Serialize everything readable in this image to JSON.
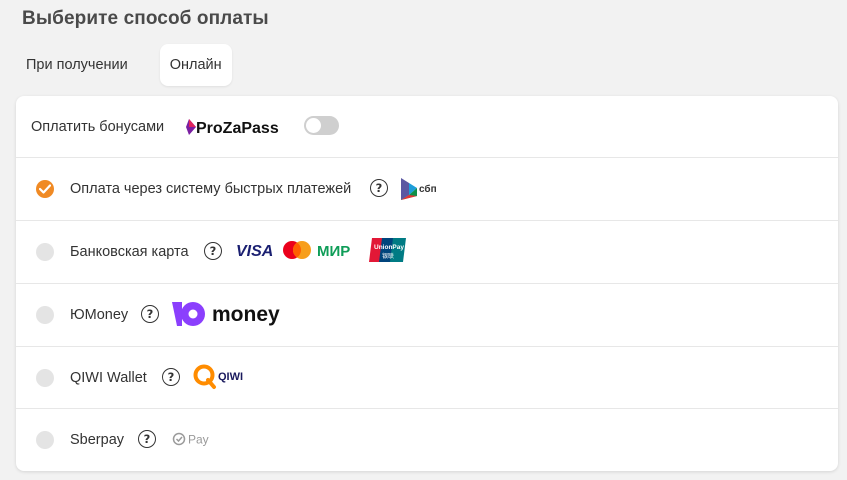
{
  "header": {
    "title": "Выберите способ оплаты"
  },
  "tabs": [
    {
      "label": "При получении",
      "active": false
    },
    {
      "label": "Онлайн",
      "active": true
    }
  ],
  "bonus": {
    "label": "Оплатить бонусами",
    "brand": "ProZaPass",
    "toggle_on": false
  },
  "methods": [
    {
      "label": "Оплата через систему быстрых платежей",
      "selected": true,
      "help": "?",
      "logo_text": "сбп"
    },
    {
      "label": "Банковская карта",
      "selected": false,
      "help": "?",
      "logos": [
        "VISA",
        "МИР",
        "UnionPay",
        "银联"
      ]
    },
    {
      "label": "ЮMoney",
      "selected": false,
      "help": "?",
      "logo_text": "money"
    },
    {
      "label": "QIWI Wallet",
      "selected": false,
      "help": "?",
      "logo_text": "QIWI"
    },
    {
      "label": "Sberpay",
      "selected": false,
      "help": "?",
      "logo_text": "Pay"
    }
  ],
  "colors": {
    "accent": "#f08a24",
    "radio_off": "#e4e4e4",
    "toggle_off": "#cfcfcf"
  }
}
